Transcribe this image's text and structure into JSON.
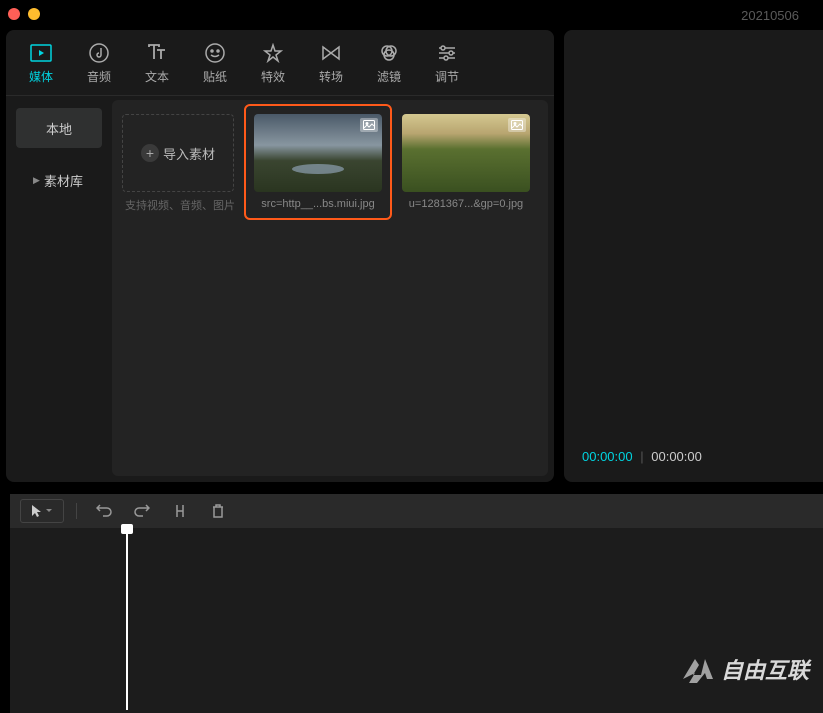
{
  "header": {
    "date": "20210506",
    "window_controls": {
      "close_color": "#ff5f57",
      "minimize_color": "#febc2e"
    }
  },
  "tabs": [
    {
      "label": "媒体",
      "icon": "media-icon",
      "active": true
    },
    {
      "label": "音频",
      "icon": "audio-icon",
      "active": false
    },
    {
      "label": "文本",
      "icon": "text-icon",
      "active": false
    },
    {
      "label": "贴纸",
      "icon": "sticker-icon",
      "active": false
    },
    {
      "label": "特效",
      "icon": "effect-icon",
      "active": false
    },
    {
      "label": "转场",
      "icon": "transition-icon",
      "active": false
    },
    {
      "label": "滤镜",
      "icon": "filter-icon",
      "active": false
    },
    {
      "label": "调节",
      "icon": "adjust-icon",
      "active": false
    }
  ],
  "sidebar": {
    "items": [
      {
        "label": "本地",
        "active": true,
        "expandable": false
      },
      {
        "label": "素材库",
        "active": false,
        "expandable": true
      }
    ]
  },
  "import": {
    "label": "导入素材",
    "sub": "支持视频、音频、图片"
  },
  "media_items": [
    {
      "name": "src=http__...bs.miui.jpg",
      "selected": true
    },
    {
      "name": "u=1281367...&gp=0.jpg",
      "selected": false
    }
  ],
  "preview": {
    "current": "00:00:00",
    "total": "00:00:00"
  },
  "watermark": {
    "text": "自由互联"
  }
}
